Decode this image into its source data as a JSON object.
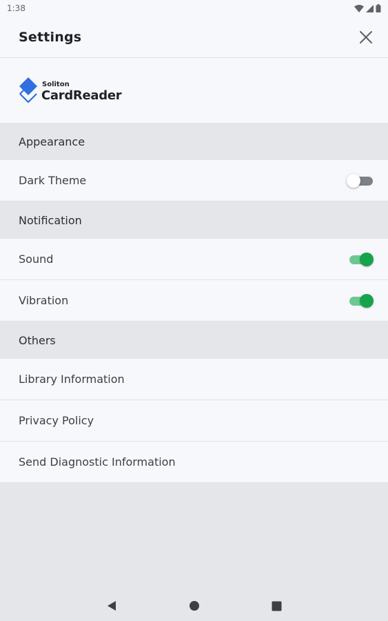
{
  "status_bar": {
    "time": "1:38"
  },
  "app_bar": {
    "title": "Settings",
    "close_icon": "close-icon"
  },
  "logo": {
    "small_text": "Soliton",
    "big_text": "CardReader",
    "brand_color": "#2f6fe0"
  },
  "sections": {
    "appearance": {
      "header": "Appearance",
      "dark_theme": {
        "label": "Dark Theme",
        "enabled": false
      }
    },
    "notification": {
      "header": "Notification",
      "sound": {
        "label": "Sound",
        "enabled": true
      },
      "vibration": {
        "label": "Vibration",
        "enabled": true
      }
    },
    "others": {
      "header": "Others",
      "items": [
        "Library Information",
        "Privacy Policy",
        "Send Diagnostic Information"
      ]
    }
  },
  "colors": {
    "accent": "#17a34a",
    "accent_track": "#6dc793",
    "section_bg": "#e4e6e9",
    "row_bg": "#f7f8fb"
  },
  "nav_bar": {
    "icons": [
      "back-icon",
      "home-icon",
      "recents-icon"
    ]
  }
}
